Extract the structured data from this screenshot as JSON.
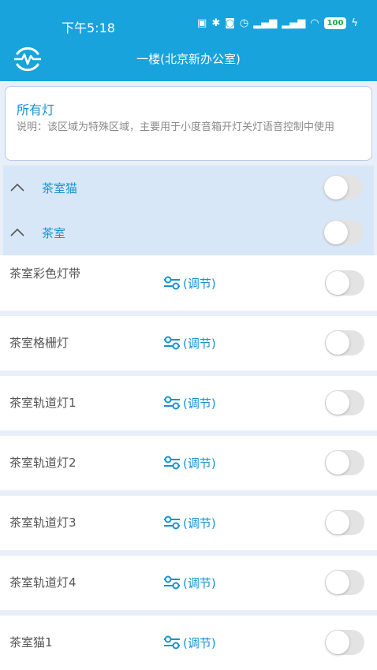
{
  "status": {
    "time": "下午5:18",
    "battery": "100"
  },
  "header": {
    "title": "一楼(北京新办公室)",
    "logo_icon": "waveform-logo-icon"
  },
  "all_lights": {
    "title": "所有灯",
    "description": "说明：该区域为特殊区域，主要用于小度音箱开灯关灯语音控制中使用"
  },
  "groups": [
    {
      "label": "茶室猫",
      "on": false
    },
    {
      "label": "茶室",
      "on": false
    }
  ],
  "devices": [
    {
      "label": "茶室彩色灯带",
      "adjust": "(调节)",
      "on": false
    },
    {
      "label": "茶室格栅灯",
      "adjust": "(调节)",
      "on": false
    },
    {
      "label": "茶室轨道灯1",
      "adjust": "(调节)",
      "on": false
    },
    {
      "label": "茶室轨道灯2",
      "adjust": "(调节)",
      "on": false
    },
    {
      "label": "茶室轨道灯3",
      "adjust": "(调节)",
      "on": false
    },
    {
      "label": "茶室轨道灯4",
      "adjust": "(调节)",
      "on": false
    },
    {
      "label": "茶室猫1",
      "adjust": "(调节)",
      "on": false
    }
  ],
  "colors": {
    "header": "#18a3dc",
    "accent": "#1793cf",
    "group_bg": "#d8e7f7"
  }
}
